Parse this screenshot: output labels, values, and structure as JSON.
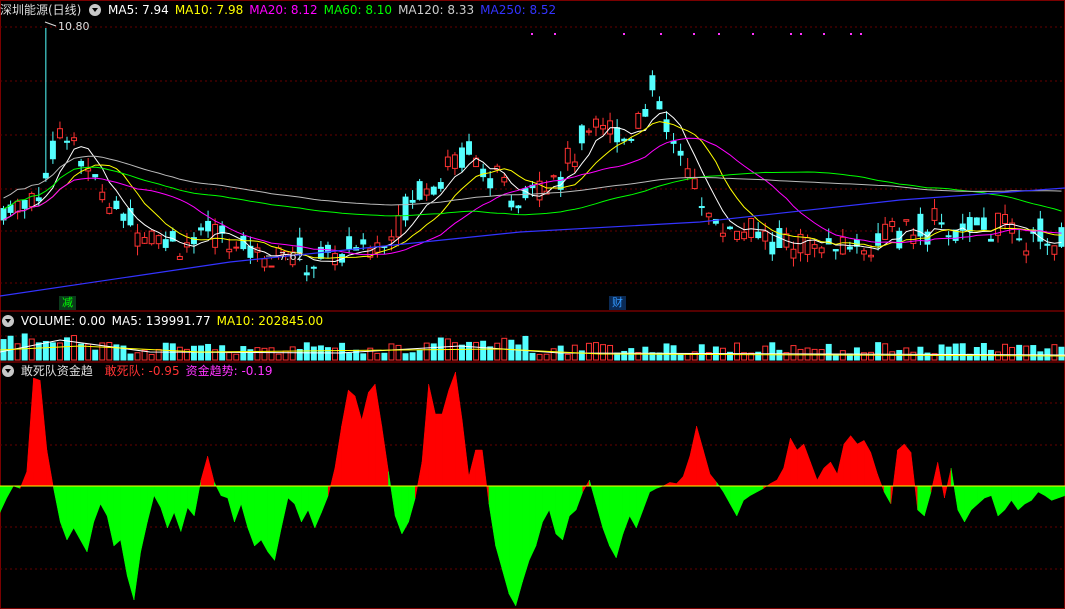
{
  "chart_data": [
    {
      "type": "candlestick",
      "title": "深圳能源(日线)",
      "indicators": [
        {
          "name": "MA5",
          "value": "7.94",
          "color": "#ffffff"
        },
        {
          "name": "MA10",
          "value": "7.98",
          "color": "#ffff00"
        },
        {
          "name": "MA20",
          "value": "8.12",
          "color": "#ff00ff"
        },
        {
          "name": "MA60",
          "value": "8.10",
          "color": "#00ff00"
        },
        {
          "name": "MA120",
          "value": "8.33",
          "color": "#cccccc"
        },
        {
          "name": "MA250",
          "value": "8.52",
          "color": "#3333ff"
        }
      ],
      "ylim": [
        7.2,
        11.2
      ],
      "high_label": "10.80",
      "low_label": "7.62",
      "markers": [
        {
          "text": "减",
          "color": "#00ff00"
        },
        {
          "text": "财",
          "color": "#3399ff"
        }
      ]
    },
    {
      "type": "bar",
      "title": "VOLUME",
      "indicators": [
        {
          "name": "VOLUME",
          "value": "0.00",
          "color": "#ffffff"
        },
        {
          "name": "MA5",
          "value": "139991.77",
          "color": "#ffffff"
        },
        {
          "name": "MA10",
          "value": "202845.00",
          "color": "#ffff00"
        }
      ]
    },
    {
      "type": "area",
      "title": "敢死队资金趋",
      "indicators": [
        {
          "name": "敢死队",
          "value": "-0.95",
          "color": "#ff3333"
        },
        {
          "name": "资金趋势",
          "value": "-0.19",
          "color": "#ff33ff"
        }
      ],
      "ylim": [
        -1,
        1
      ],
      "values": [
        -0.22,
        -0.1,
        0,
        -0.02,
        0.12,
        0.9,
        0.88,
        0.3,
        -0.02,
        -0.3,
        -0.45,
        -0.35,
        -0.45,
        -0.55,
        -0.3,
        -0.15,
        -0.25,
        -0.5,
        -0.45,
        -0.75,
        -0.95,
        -0.55,
        -0.3,
        -0.08,
        -0.18,
        -0.35,
        -0.22,
        -0.38,
        -0.18,
        -0.25,
        0.05,
        0.25,
        0.03,
        -0.08,
        -0.1,
        -0.3,
        -0.15,
        -0.35,
        -0.5,
        -0.45,
        -0.55,
        -0.62,
        -0.35,
        -0.1,
        -0.15,
        -0.3,
        -0.2,
        -0.35,
        -0.22,
        -0.08,
        0.15,
        0.5,
        0.8,
        0.75,
        0.55,
        0.78,
        0.85,
        0.5,
        0.12,
        -0.25,
        -0.4,
        -0.3,
        -0.1,
        0.2,
        0.85,
        0.6,
        0.6,
        0.8,
        0.95,
        0.55,
        0.08,
        0.3,
        0.3,
        -0.15,
        -0.5,
        -0.7,
        -0.9,
        -1.0,
        -0.8,
        -0.62,
        -0.5,
        -0.3,
        -0.2,
        -0.4,
        -0.45,
        -0.25,
        -0.2,
        -0.05,
        0.05,
        -0.15,
        -0.35,
        -0.5,
        -0.6,
        -0.4,
        -0.25,
        -0.35,
        -0.2,
        -0.05,
        -0.02,
        0.0,
        0.03,
        0.02,
        0.08,
        0.25,
        0.5,
        0.3,
        0.1,
        0.03,
        -0.05,
        -0.15,
        -0.25,
        -0.12,
        -0.08,
        -0.05,
        -0.02,
        0.02,
        0.05,
        0.15,
        0.4,
        0.3,
        0.35,
        0.2,
        0.05,
        0.15,
        0.2,
        0.1,
        0.35,
        0.42,
        0.35,
        0.38,
        0.28,
        0.1,
        -0.05,
        -0.15,
        0.3,
        0.35,
        0.28,
        -0.2,
        -0.25,
        -0.05,
        0.2,
        -0.1,
        0.15,
        -0.2,
        -0.3,
        -0.2,
        -0.15,
        -0.1,
        -0.08,
        -0.25,
        -0.2,
        -0.12,
        -0.2,
        -0.15,
        -0.12,
        -0.05,
        -0.08,
        -0.12,
        -0.1,
        -0.08
      ]
    }
  ]
}
